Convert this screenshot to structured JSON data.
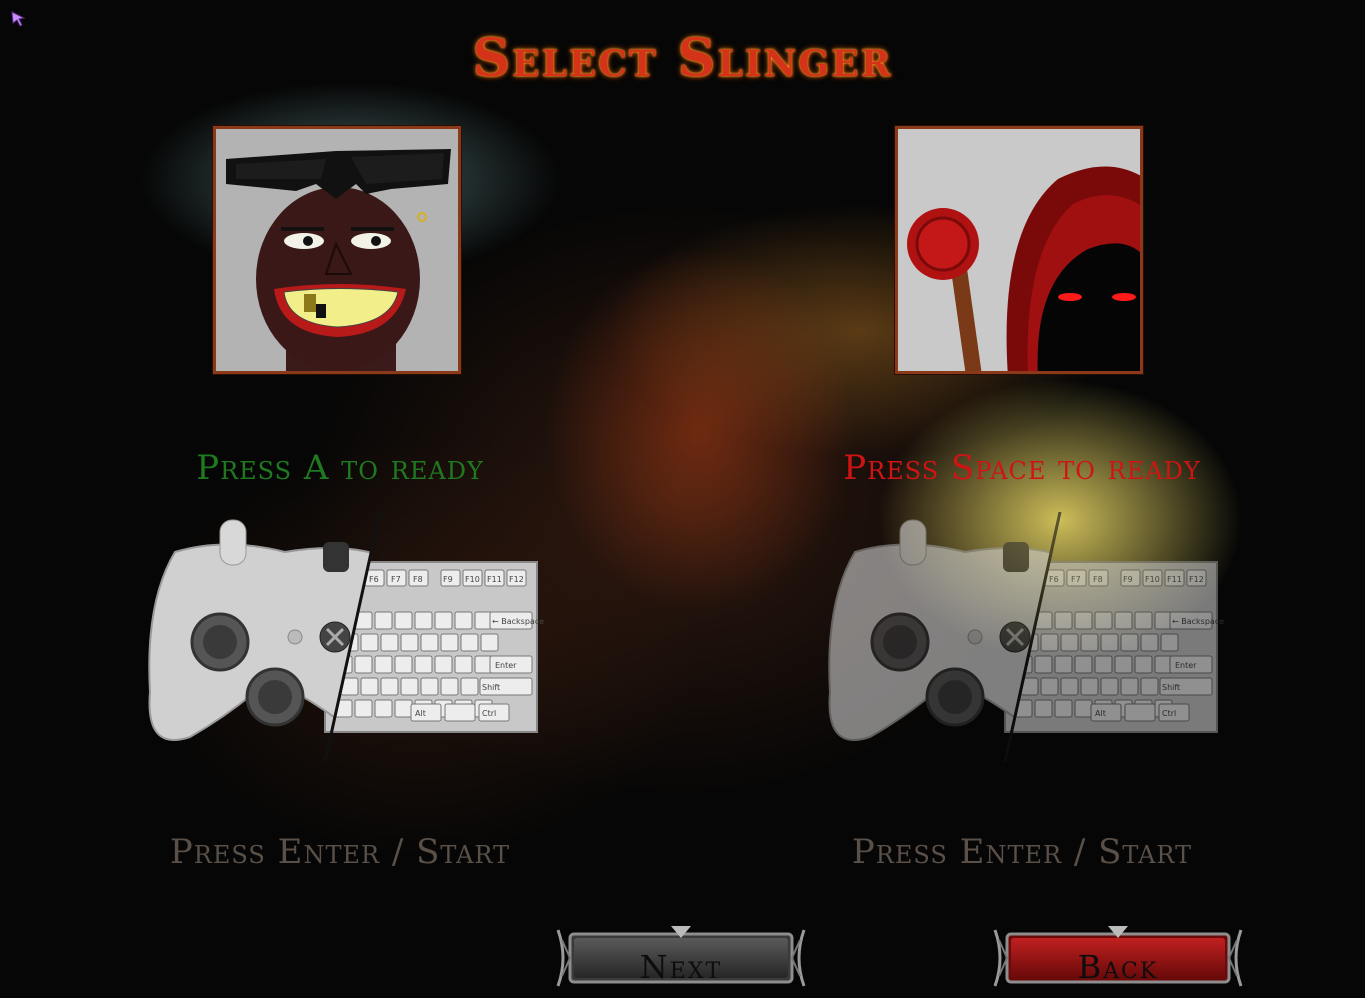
{
  "screen": {
    "title": "Select Slinger"
  },
  "players": [
    {
      "ready_prompt": "Press A to ready",
      "ready_color": "#1f7a1f",
      "start_prompt": "Press Enter / Start",
      "portrait_icon": "grinning-slinger-portrait-icon"
    },
    {
      "ready_prompt": "Press Space to ready",
      "ready_color": "#d01414",
      "start_prompt": "Press Enter / Start",
      "portrait_icon": "hooded-slinger-portrait-icon"
    }
  ],
  "buttons": {
    "next_label": "Next",
    "back_label": "Back"
  },
  "keyboard": {
    "f_keys_left": [
      "F6",
      "F7",
      "F8"
    ],
    "f_keys_right": [
      "F9",
      "F10",
      "F11",
      "F12"
    ],
    "backspace": "← Backspace",
    "enter": "Enter",
    "shift": "Shift",
    "alt": "Alt",
    "ctrl": "Ctrl"
  },
  "colors": {
    "title": "#d4331a",
    "frame": "#8a3a18",
    "start_prompt": "#5a5048",
    "next_button": "#3a3a3a",
    "back_button": "#8a1515"
  }
}
